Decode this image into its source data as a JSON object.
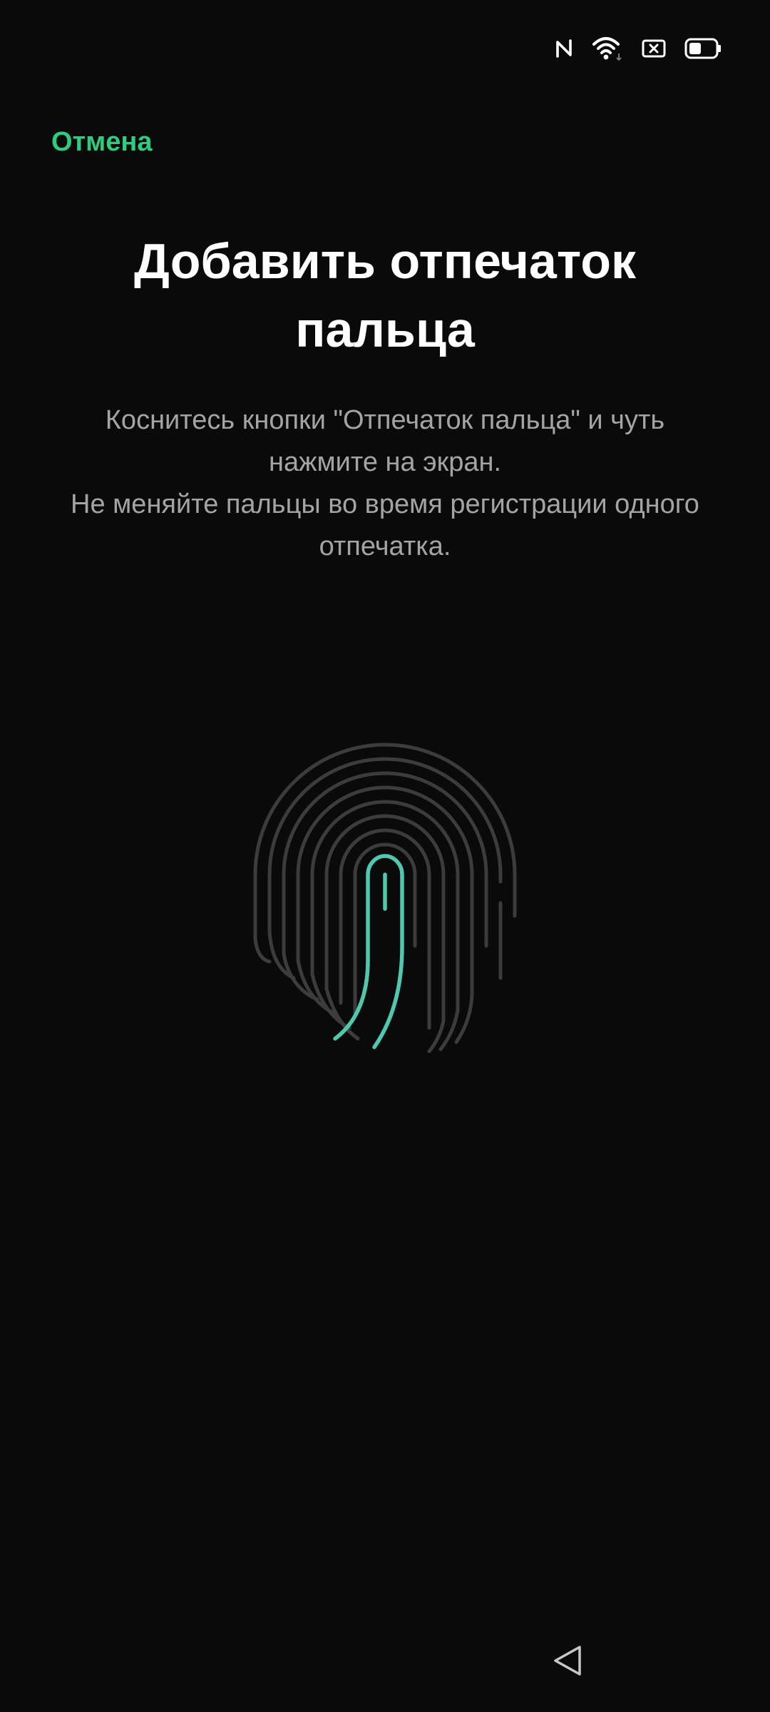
{
  "status_bar": {
    "icons": [
      "nfc-icon",
      "wifi-icon",
      "no-sim-icon",
      "battery-icon"
    ]
  },
  "header": {
    "cancel_label": "Отмена"
  },
  "main": {
    "title": "Добавить отпечаток пальца",
    "instructions": [
      "Коснитесь кнопки \"Отпечаток пальца\" и чуть нажмите на экран.",
      "Не меняйте пальцы во время регистрации одного отпечатка."
    ],
    "fingerprint_icon": "fingerprint-icon"
  },
  "navigation": {
    "back_icon": "back-triangle-icon"
  },
  "colors": {
    "background": "#0a0a0a",
    "accent": "#2ecc80",
    "fingerprint_progress": "#4fc8b0",
    "fingerprint_inactive": "#3c3c3c",
    "secondary_text": "#a4a4a4"
  }
}
